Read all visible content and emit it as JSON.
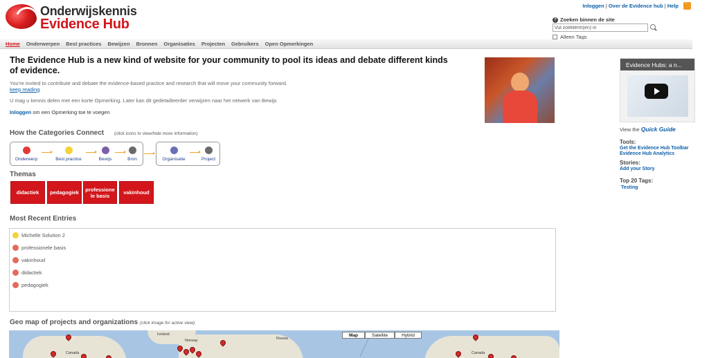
{
  "header": {
    "logo_top": "Onderwijskennis",
    "logo_bottom": "Evidence Hub",
    "links": [
      "Inloggen",
      "Over de Evidence hub",
      "Help"
    ],
    "separator": "|"
  },
  "search": {
    "label": "Zoeken binnen de site",
    "placeholder": "Vul zoekterm(en) in",
    "tags_label": "Alleen Tags"
  },
  "nav": [
    "Home",
    "Onderwerpen",
    "Best practices",
    "Bewijzen",
    "Bronnen",
    "Organisaties",
    "Projecten",
    "Gebruikers",
    "Open Opmerkingen"
  ],
  "intro": {
    "title": "The Evidence Hub is a new kind of website for your community to pool its ideas and debate different kinds of evidence.",
    "text1": "You're invited to contribute and debate the evidence-based practice and research that will move your community forward.",
    "keep_reading": "keep reading",
    "text2": "U mag u kennis delen met een korte Opmerking. Later kan dit gedetailleerder verwijzen naar het netwerk van Bewijs",
    "login_link": "Inloggen",
    "login_rest": " om een Opmerking toe te voegen"
  },
  "categories": {
    "heading": "How the Categories Connect",
    "note": "(click icons to view/hide more information)",
    "group1": [
      "Onderwerp",
      "Best practice",
      "Bewijs",
      "Bron"
    ],
    "group2": [
      "Organisatie",
      "Project"
    ]
  },
  "themas": {
    "heading": "Themas",
    "items": [
      "didactiek",
      "pedagogiek",
      "professione le basis",
      "vakinhoud"
    ]
  },
  "recent": {
    "heading": "Most Recent Entries",
    "items": [
      "Michelle Solution 2",
      "professionele basis",
      "vakinhoud",
      "didactiek",
      "pedagogiek"
    ]
  },
  "geo": {
    "heading": "Geo map of projects and organizations",
    "note": "(click image for active view)",
    "buttons": [
      "Map",
      "Satellite",
      "Hybrid"
    ],
    "labels": [
      "Iceland",
      "Norway",
      "Russia",
      "Canada",
      "Canada"
    ]
  },
  "sidebar": {
    "video_title": "Evidence Hubs: a n...",
    "view_the": "View the ",
    "quick_guide": "Quick Guide",
    "tools_heading": "Tools:",
    "tools": [
      "Get the Evidence Hub Toolbar",
      "Evidence Hub Analytics"
    ],
    "stories_heading": "Stories:",
    "stories_link": "Add your Story",
    "tags_heading": "Top 20 Tags:",
    "tag": "Testing"
  },
  "colors": {
    "brand_red": "#d2161c",
    "link_blue": "#0d5ea8"
  }
}
